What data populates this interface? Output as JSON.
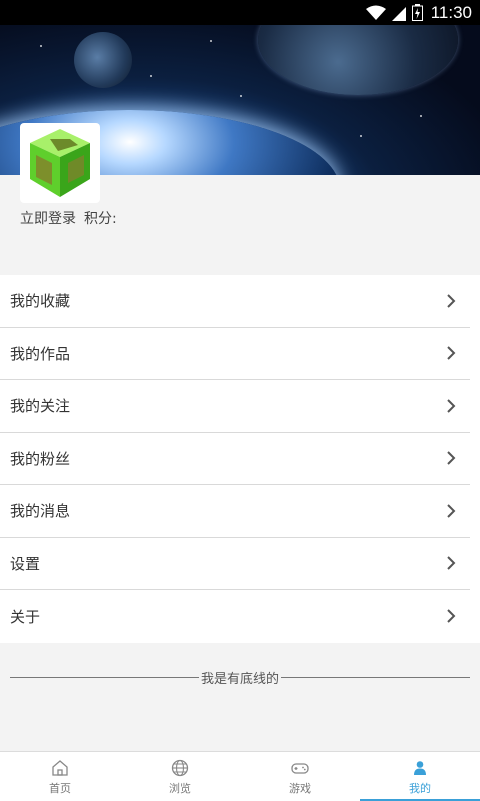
{
  "status_bar": {
    "time": "11:30",
    "icons": [
      "wifi-icon",
      "signal-icon",
      "battery-icon"
    ]
  },
  "profile": {
    "avatar": "app-logo-cube",
    "login_label": "立即登录",
    "points_label": "积分:"
  },
  "menu": {
    "items": [
      {
        "label": "我的收藏"
      },
      {
        "label": "我的作品"
      },
      {
        "label": "我的关注"
      },
      {
        "label": "我的粉丝"
      },
      {
        "label": "我的消息"
      },
      {
        "label": "设置"
      },
      {
        "label": "关于"
      }
    ]
  },
  "footer_note": "我是有底线的",
  "tabbar": {
    "active_color": "#3aa0d8",
    "tabs": [
      {
        "label": "首页",
        "icon": "home-icon"
      },
      {
        "label": "浏览",
        "icon": "globe-icon"
      },
      {
        "label": "游戏",
        "icon": "gamepad-icon"
      },
      {
        "label": "我的",
        "icon": "user-icon",
        "active": true
      }
    ]
  }
}
